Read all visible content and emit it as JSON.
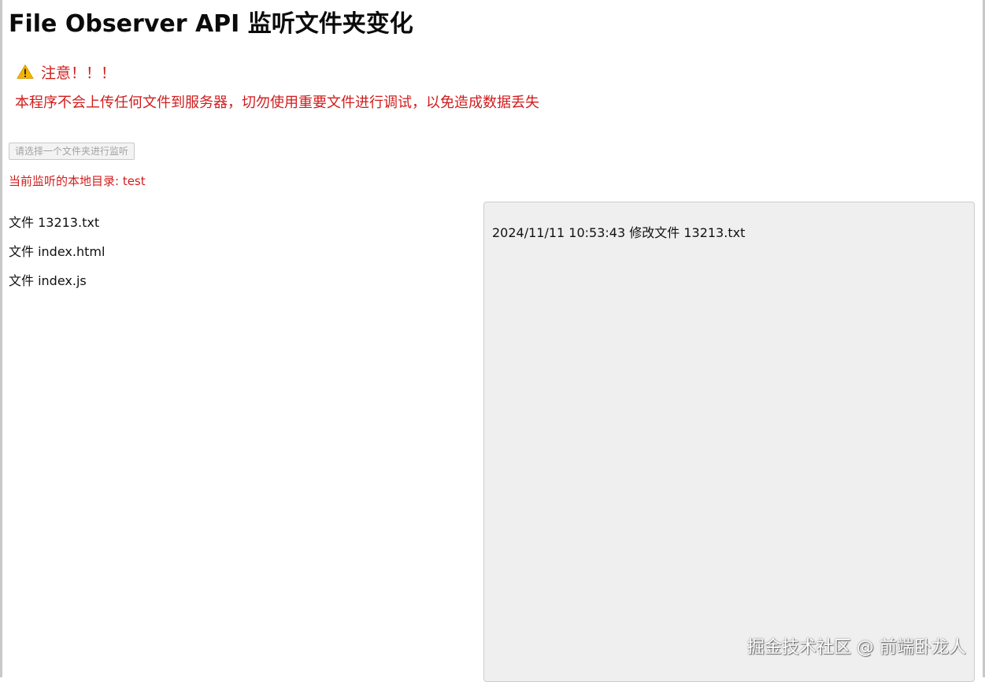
{
  "page": {
    "title": "File Observer API 监听文件夹变化"
  },
  "notice": {
    "icon": "warning-icon",
    "heading": "注意！！！",
    "body": "本程序不会上传任何文件到服务器，切勿使用重要文件进行调试，以免造成数据丢失",
    "color": "#d11c1c"
  },
  "controls": {
    "pick_folder_label": "请选择一个文件夹进行监听"
  },
  "status": {
    "current_dir_label": "当前监听的本地目录: test"
  },
  "files": [
    {
      "label": "文件 13213.txt"
    },
    {
      "label": "文件 index.html"
    },
    {
      "label": "文件 index.js"
    }
  ],
  "log": [
    {
      "text": "2024/11/11 10:53:43 修改文件 13213.txt"
    }
  ],
  "watermark": {
    "text": "掘金技术社区 @ 前端卧龙人"
  }
}
